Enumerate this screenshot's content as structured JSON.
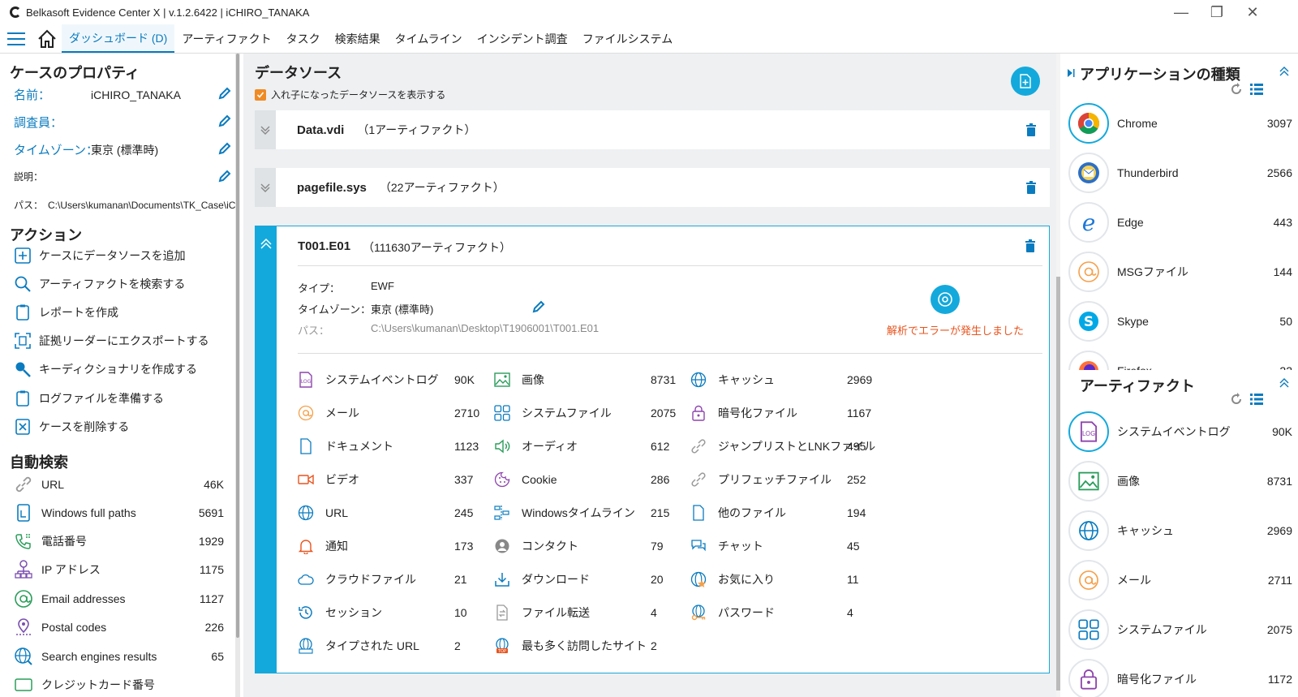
{
  "window": {
    "title": "Belkasoft Evidence Center X | v.1.2.6422 | iCHIRO_TANAKA",
    "minimize": "—",
    "restore": "❐",
    "close": "✕"
  },
  "menu": {
    "items": [
      "ダッシュボード (D)",
      "アーティファクト",
      "タスク",
      "検索結果",
      "タイムライン",
      "インシデント調査",
      "ファイルシステム"
    ]
  },
  "properties": {
    "title": "ケースのプロパティ",
    "name_label": "名前：",
    "name_value": "iCHIRO_TANAKA",
    "investigator_label": "調査員：",
    "timezone_label": "タイムゾーン：",
    "timezone_value": "東京 (標準時)",
    "desc_label": "説明：",
    "path_label": "パス：",
    "path_value": "C:\\Users\\kumanan\\Documents\\TK_Case\\iCHIRO_TANAKA"
  },
  "actions": {
    "title": "アクション",
    "items": [
      "ケースにデータソースを追加",
      "アーティファクトを検索する",
      "レポートを作成",
      "証拠リーダーにエクスポートする",
      "キーディクショナリを作成する",
      "ログファイルを準備する",
      "ケースを削除する"
    ]
  },
  "autosearch": {
    "title": "自動検索",
    "items": [
      {
        "label": "URL",
        "count": "46K"
      },
      {
        "label": "Windows full paths",
        "count": "5691"
      },
      {
        "label": "電話番号",
        "count": "1929"
      },
      {
        "label": "IP アドレス",
        "count": "1175"
      },
      {
        "label": "Email addresses",
        "count": "1127"
      },
      {
        "label": "Postal codes",
        "count": "226"
      },
      {
        "label": "Search engines results",
        "count": "65"
      },
      {
        "label": "クレジットカード番号",
        "count": ""
      }
    ]
  },
  "datasources": {
    "title": "データソース",
    "nested_checkbox": "入れ子になったデータソースを表示する",
    "nested_checked": true,
    "rows": [
      {
        "name": "Data.vdi",
        "artifacts": "（1アーティファクト）"
      },
      {
        "name": "pagefile.sys",
        "artifacts": "（22アーティファクト）"
      }
    ],
    "expanded": {
      "name": "T001.E01",
      "artifacts": "（111630アーティファクト）",
      "type_label": "タイプ：",
      "type_value": "EWF",
      "tz_label": "タイムゾーン：",
      "tz_value": "東京 (標準時)",
      "path_label": "パス：",
      "path_value": "C:\\Users\\kumanan\\Desktop\\T1906001\\T001.E01",
      "error": "解析でエラーが発生しました",
      "artifacts_grid": [
        {
          "label": "システムイベントログ",
          "count": "90K",
          "icon": "log-icon"
        },
        {
          "label": "画像",
          "count": "8731",
          "icon": "image-icon"
        },
        {
          "label": "キャッシュ",
          "count": "2969",
          "icon": "globe-icon"
        },
        {
          "label": "メール",
          "count": "2710",
          "icon": "at-icon"
        },
        {
          "label": "システムファイル",
          "count": "2075",
          "icon": "system-file-icon"
        },
        {
          "label": "暗号化ファイル",
          "count": "1167",
          "icon": "lock-icon"
        },
        {
          "label": "ドキュメント",
          "count": "1123",
          "icon": "document-icon"
        },
        {
          "label": "オーディオ",
          "count": "612",
          "icon": "speaker-icon"
        },
        {
          "label": "ジャンプリストとLNKファイル",
          "count": "495",
          "icon": "link-icon"
        },
        {
          "label": "ビデオ",
          "count": "337",
          "icon": "video-icon"
        },
        {
          "label": "Cookie",
          "count": "286",
          "icon": "cookie-icon"
        },
        {
          "label": "プリフェッチファイル",
          "count": "252",
          "icon": "link-icon"
        },
        {
          "label": "URL",
          "count": "245",
          "icon": "globe-icon"
        },
        {
          "label": "Windowsタイムライン",
          "count": "215",
          "icon": "timeline-icon"
        },
        {
          "label": "他のファイル",
          "count": "194",
          "icon": "file-icon"
        },
        {
          "label": "通知",
          "count": "173",
          "icon": "bell-icon"
        },
        {
          "label": "コンタクト",
          "count": "79",
          "icon": "contact-icon"
        },
        {
          "label": "チャット",
          "count": "45",
          "icon": "chat-icon"
        },
        {
          "label": "クラウドファイル",
          "count": "21",
          "icon": "cloud-icon"
        },
        {
          "label": "ダウンロード",
          "count": "20",
          "icon": "download-icon"
        },
        {
          "label": "お気に入り",
          "count": "11",
          "icon": "favorite-globe-icon"
        },
        {
          "label": "セッション",
          "count": "10",
          "icon": "history-icon"
        },
        {
          "label": "ファイル転送",
          "count": "4",
          "icon": "transfer-icon"
        },
        {
          "label": "パスワード",
          "count": "4",
          "icon": "key-globe-icon"
        },
        {
          "label": "タイプされた URL",
          "count": "2",
          "icon": "typed-url-icon"
        },
        {
          "label": "最も多く訪問したサイト",
          "count": "2",
          "icon": "top-sites-icon"
        }
      ]
    }
  },
  "apps": {
    "title": "アプリケーションの種類",
    "items": [
      {
        "label": "Chrome",
        "count": "3097"
      },
      {
        "label": "Thunderbird",
        "count": "2566"
      },
      {
        "label": "Edge",
        "count": "443"
      },
      {
        "label": "MSGファイル",
        "count": "144"
      },
      {
        "label": "Skype",
        "count": "50"
      },
      {
        "label": "Firefox",
        "count": "22"
      }
    ]
  },
  "artifacts_panel": {
    "title": "アーティファクト",
    "items": [
      {
        "label": "システムイベントログ",
        "count": "90K"
      },
      {
        "label": "画像",
        "count": "8731"
      },
      {
        "label": "キャッシュ",
        "count": "2969"
      },
      {
        "label": "メール",
        "count": "2711"
      },
      {
        "label": "システムファイル",
        "count": "2075"
      },
      {
        "label": "暗号化ファイル",
        "count": "1172"
      }
    ]
  },
  "colors": {
    "accent": "#14a9dc",
    "link": "#0a7bbf",
    "error": "#e8541e",
    "purple": "#8e44ad",
    "orange": "#f5a04a"
  }
}
